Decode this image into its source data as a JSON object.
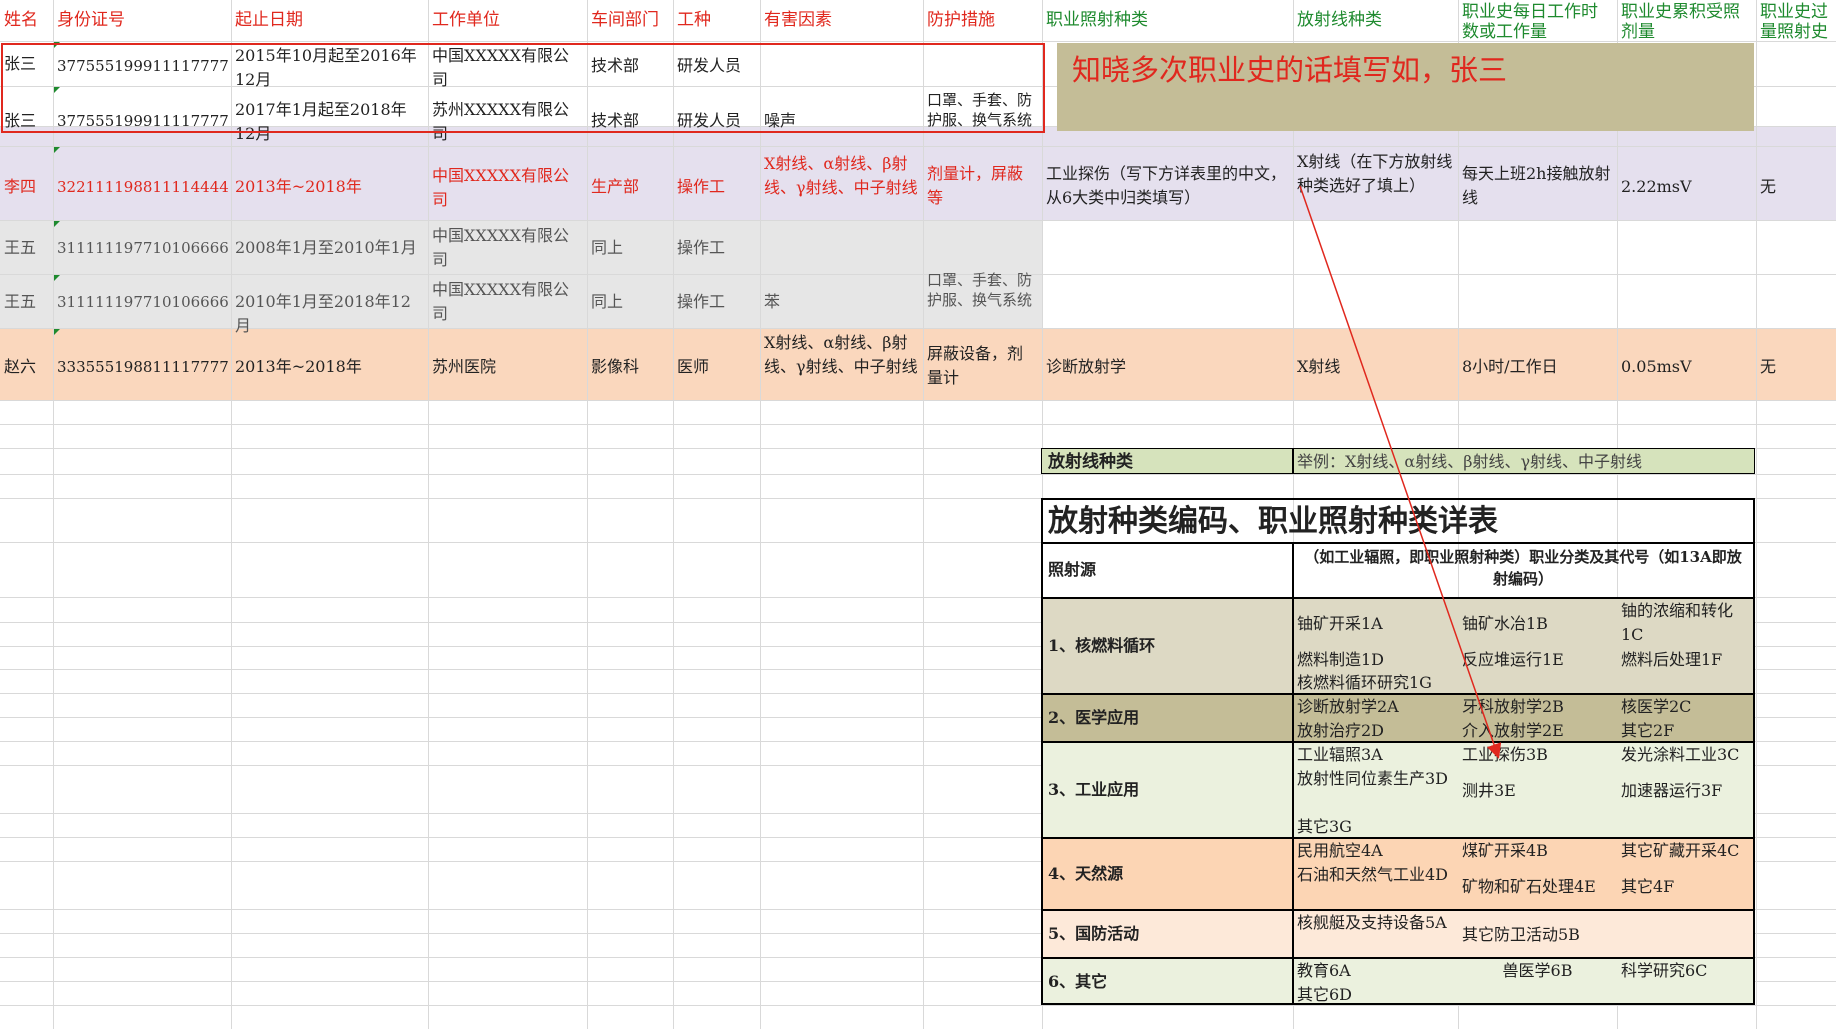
{
  "headers": [
    "姓名",
    "身份证号",
    "起止日期",
    "工作单位",
    "车间部门",
    "工种",
    "有害因素",
    "防护措施",
    "职业照射种类",
    "放射线种类",
    "职业史每日工作时数或工作量",
    "职业史累积受照剂量",
    "职业史过量照射史"
  ],
  "rows": [
    {
      "name": "张三",
      "id": "377555199911117777",
      "dates": "2015年10月起至2016年12月",
      "employer": "中国XXXXX有限公司",
      "dept": "技术部",
      "job": "研发人员",
      "hazard": "",
      "protection": "",
      "exposure_type": "",
      "radiation_type": "",
      "hours": "",
      "dose": "",
      "overdose": ""
    },
    {
      "name": "张三",
      "id": "377555199911117777",
      "dates": "2017年1月起至2018年12月",
      "employer": "苏州XXXXX有限公司",
      "dept": "技术部",
      "job": "研发人员",
      "hazard": "噪声",
      "protection": "口罩、手套、防护服、换气系统",
      "exposure_type": "",
      "radiation_type": "",
      "hours": "",
      "dose": "",
      "overdose": ""
    },
    {
      "name": "李四",
      "id": "322111198811114444",
      "dates": "2013年~2018年",
      "employer": "中国XXXXX有限公司",
      "dept": "生产部",
      "job": "操作工",
      "hazard": "X射线、α射线、β射线、γ射线、中子射线",
      "protection": "剂量计，屏蔽等",
      "exposure_type": "工业探伤（写下方详表里的中文，从6大类中归类填写）",
      "radiation_type": "X射线（在下方放射线种类选好了填上）",
      "hours": "每天上班2h接触放射线",
      "dose": "2.22msV",
      "overdose": "无"
    },
    {
      "name": "王五",
      "id": "311111197710106666",
      "dates": "2008年1月至2010年1月",
      "employer": "中国XXXXX有限公司",
      "dept": "同上",
      "job": "操作工",
      "hazard": "",
      "protection": "",
      "exposure_type": "",
      "radiation_type": "",
      "hours": "",
      "dose": "",
      "overdose": ""
    },
    {
      "name": "王五",
      "id": "311111197710106666",
      "dates": "2010年1月至2018年12月",
      "employer": "中国XXXXX有限公司",
      "dept": "同上",
      "job": "操作工",
      "hazard": "苯",
      "protection": "口罩、手套、防护服、换气系统",
      "exposure_type": "",
      "radiation_type": "",
      "hours": "",
      "dose": "",
      "overdose": ""
    },
    {
      "name": "赵六",
      "id": "333555198811117777",
      "dates": "2013年~2018年",
      "employer": "苏州医院",
      "dept": "影像科",
      "job": "医师",
      "hazard": "X射线、α射线、β射线、γ射线、中子射线",
      "protection": "屏蔽设备，剂量计",
      "exposure_type": "诊断放射学",
      "radiation_type": "X射线",
      "hours": "8小时/工作日",
      "dose": "0.05msV",
      "overdose": "无"
    }
  ],
  "note": "知晓多次职业史的话填写如，张三",
  "radiation_types": {
    "label": "放射线种类",
    "example": "举例：X射线、α射线、β射线、γ射线、中子射线"
  },
  "table": {
    "title": "放射种类编码、职业照射种类详表",
    "col1_header": "照射源",
    "col2_header": "（如工业辐照，即职业照射种类）职业分类及其代号（如13A即放射编码）",
    "groups": [
      {
        "name": "1、核燃料循环",
        "items": [
          "铀矿开采1A",
          "铀矿水冶1B",
          "铀的浓缩和转化1C",
          "燃料制造1D",
          "反应堆运行1E",
          "燃料后处理1F",
          "核燃料循环研究1G"
        ]
      },
      {
        "name": "2、医学应用",
        "items": [
          "诊断放射学2A",
          "牙科放射学2B",
          "核医学2C",
          "放射治疗2D",
          "介入放射学2E",
          "其它2F"
        ]
      },
      {
        "name": "3、工业应用",
        "items": [
          "工业辐照3A",
          "工业探伤3B",
          "发光涂料工业3C",
          "放射性同位素生产3D",
          "测井3E",
          "加速器运行3F",
          "其它3G"
        ]
      },
      {
        "name": "4、天然源",
        "items": [
          "民用航空4A",
          "煤矿开采4B",
          "其它矿藏开采4C",
          "石油和天然气工业4D",
          "矿物和矿石处理4E",
          "其它4F"
        ]
      },
      {
        "name": "5、国防活动",
        "items": [
          "核舰艇及支持设备5A",
          "其它防卫活动5B"
        ]
      },
      {
        "name": "6、其它",
        "items": [
          "教育6A",
          "兽医学6B",
          "科学研究6C",
          "其它6D"
        ]
      }
    ]
  },
  "colors": {
    "header_red": "#e0281e",
    "header_green": "#1e8a2e",
    "lisi_bg": "#e5e0ee",
    "wangwu_bg": "#e6e6e6",
    "zhaoliu_bg": "#fad7bd",
    "note_bg": "#c4bd97",
    "rad_bg": "#d6e3bc",
    "g1": "#ddd9c4",
    "g2": "#c4bd97",
    "g3": "#ebf1de",
    "g4": "#fcd5b4",
    "g5": "#fde9d9",
    "g6": "#ebf1de"
  }
}
